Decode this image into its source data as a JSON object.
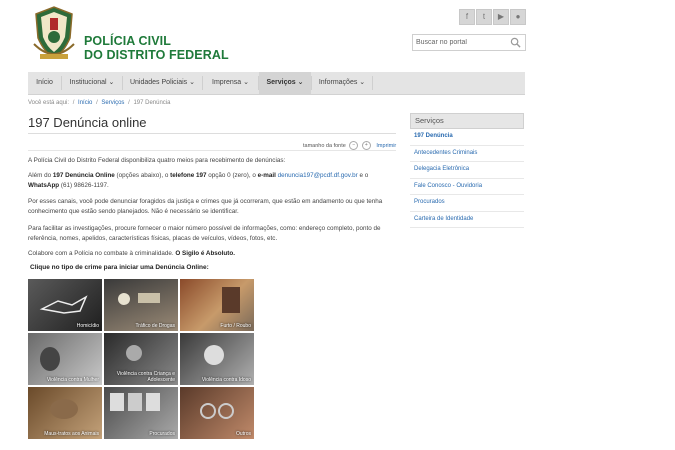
{
  "header": {
    "brand_line1": "POLÍCIA CIVIL",
    "brand_line2": "DO DISTRITO FEDERAL",
    "social": [
      {
        "icon": "facebook-icon",
        "glyph": "f"
      },
      {
        "icon": "twitter-icon",
        "glyph": "t"
      },
      {
        "icon": "youtube-icon",
        "glyph": "▶"
      },
      {
        "icon": "flickr-icon",
        "glyph": "●"
      }
    ],
    "search_placeholder": "Buscar no portal"
  },
  "nav": {
    "items": [
      {
        "label": "Início"
      },
      {
        "label": "Institucional ⌄"
      },
      {
        "label": "Unidades Policiais ⌄"
      },
      {
        "label": "Imprensa ⌄"
      },
      {
        "label": "Serviços ⌄"
      },
      {
        "label": "Informações ⌄"
      }
    ]
  },
  "breadcrumb": {
    "prefix": "Você está aqui:",
    "items": [
      "Início",
      "Serviços",
      "197 Denúncia"
    ]
  },
  "main": {
    "title": "197 Denúncia online",
    "tools": {
      "font_label": "tamanho da fonte",
      "minus": "−",
      "plus": "+",
      "print": "Imprimir"
    },
    "para1": "A Polícia Civil do Distrito Federal disponibiliza quatro meios para recebimento de denúncias:",
    "para2": {
      "t1": "Além do ",
      "b1": "197 Denúncia Online",
      "t2": " (opções abaixo), o ",
      "b2": "telefone 197",
      "t3": " opção 0 (zero), o ",
      "b3": "e-mail",
      "email": "denuncia197@pcdf.df.gov.br",
      "t4": " e o ",
      "b4": "WhatsApp",
      "t5": " (61) 98626-1197."
    },
    "para3": "Por esses canais, você pode denunciar foragidos da justiça e crimes que já ocorreram, que estão em andamento ou que tenha conhecimento que estão sendo planejados. Não é necessário se identificar.",
    "para4": "Para facilitar as investigações, procure fornecer o maior número possível de informações, como: endereço completo, ponto de referência, nomes, apelidos, características físicas, placas de veículos, vídeos, fotos, etc.",
    "para5": {
      "t1": "Colabore com a Polícia no combate à criminalidade. ",
      "b1": "O Sigilo é Absoluto."
    },
    "cta": "Clique no tipo de crime para iniciar uma Denúncia Online:",
    "tiles": [
      {
        "label": "Homicídio"
      },
      {
        "label": "Tráfico de Drogas"
      },
      {
        "label": "Furto / Roubo"
      },
      {
        "label": "Violência contra Mulher"
      },
      {
        "label": "Violência contra Criança e Adolescente"
      },
      {
        "label": "Violência contra Idoso"
      },
      {
        "label": "Maus-tratos aos Animais"
      },
      {
        "label": "Procurados"
      },
      {
        "label": "Outros"
      }
    ]
  },
  "sidebar": {
    "title": "Serviços",
    "links": [
      {
        "label": "197 Denúncia"
      },
      {
        "label": "Antecedentes Criminais"
      },
      {
        "label": "Delegacia Eletrônica"
      },
      {
        "label": "Fale Conosco - Ouvidoria"
      },
      {
        "label": "Procurados"
      },
      {
        "label": "Carteira de Identidade"
      }
    ]
  },
  "colors": {
    "brand_green": "#1f7a3a",
    "link_blue": "#2a6bb0",
    "nav_bg": "#e4e4e4"
  }
}
